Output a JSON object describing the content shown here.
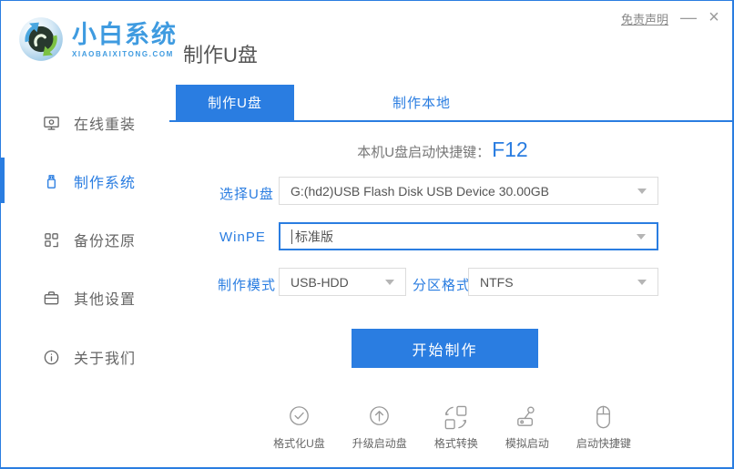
{
  "colors": {
    "accent": "#2a7de1",
    "logo_blue": "#3f9be0",
    "text_gray": "#666666",
    "border_gray": "#dcdcdc",
    "icon_gray": "#9a9a9a"
  },
  "header": {
    "logo_title": "小白系统",
    "logo_subtitle": "XIAOBAIXITONG.COM",
    "page_title": "制作U盘",
    "disclaimer": "免责声明",
    "minimize": "—",
    "close": "×"
  },
  "sidebar": {
    "items": [
      {
        "icon": "monitor-icon",
        "label": "在线重装",
        "active": false
      },
      {
        "icon": "usb-drive-icon",
        "label": "制作系统",
        "active": true
      },
      {
        "icon": "grid-icon",
        "label": "备份还原",
        "active": false
      },
      {
        "icon": "briefcase-icon",
        "label": "其他设置",
        "active": false
      },
      {
        "icon": "info-icon",
        "label": "关于我们",
        "active": false
      }
    ]
  },
  "tabs": [
    {
      "label": "制作U盘",
      "active": true
    },
    {
      "label": "制作本地",
      "active": false
    }
  ],
  "hotkey": {
    "prefix": "本机U盘启动快捷键：",
    "key": "F12"
  },
  "form": {
    "usb": {
      "label": "选择U盘",
      "value": "G:(hd2)USB Flash Disk USB Device 30.00GB"
    },
    "winpe": {
      "label": "WinPE",
      "value": "标准版"
    },
    "mode": {
      "label": "制作模式",
      "value": "USB-HDD"
    },
    "partition": {
      "label": "分区格式",
      "value": "NTFS"
    }
  },
  "start_button": "开始制作",
  "footer_tools": [
    {
      "icon": "check-circle-icon",
      "label": "格式化U盘"
    },
    {
      "icon": "arrow-up-circle-icon",
      "label": "升级启动盘"
    },
    {
      "icon": "convert-icon",
      "label": "格式转换"
    },
    {
      "icon": "joystick-icon",
      "label": "模拟启动"
    },
    {
      "icon": "mouse-icon",
      "label": "启动快捷键"
    }
  ]
}
